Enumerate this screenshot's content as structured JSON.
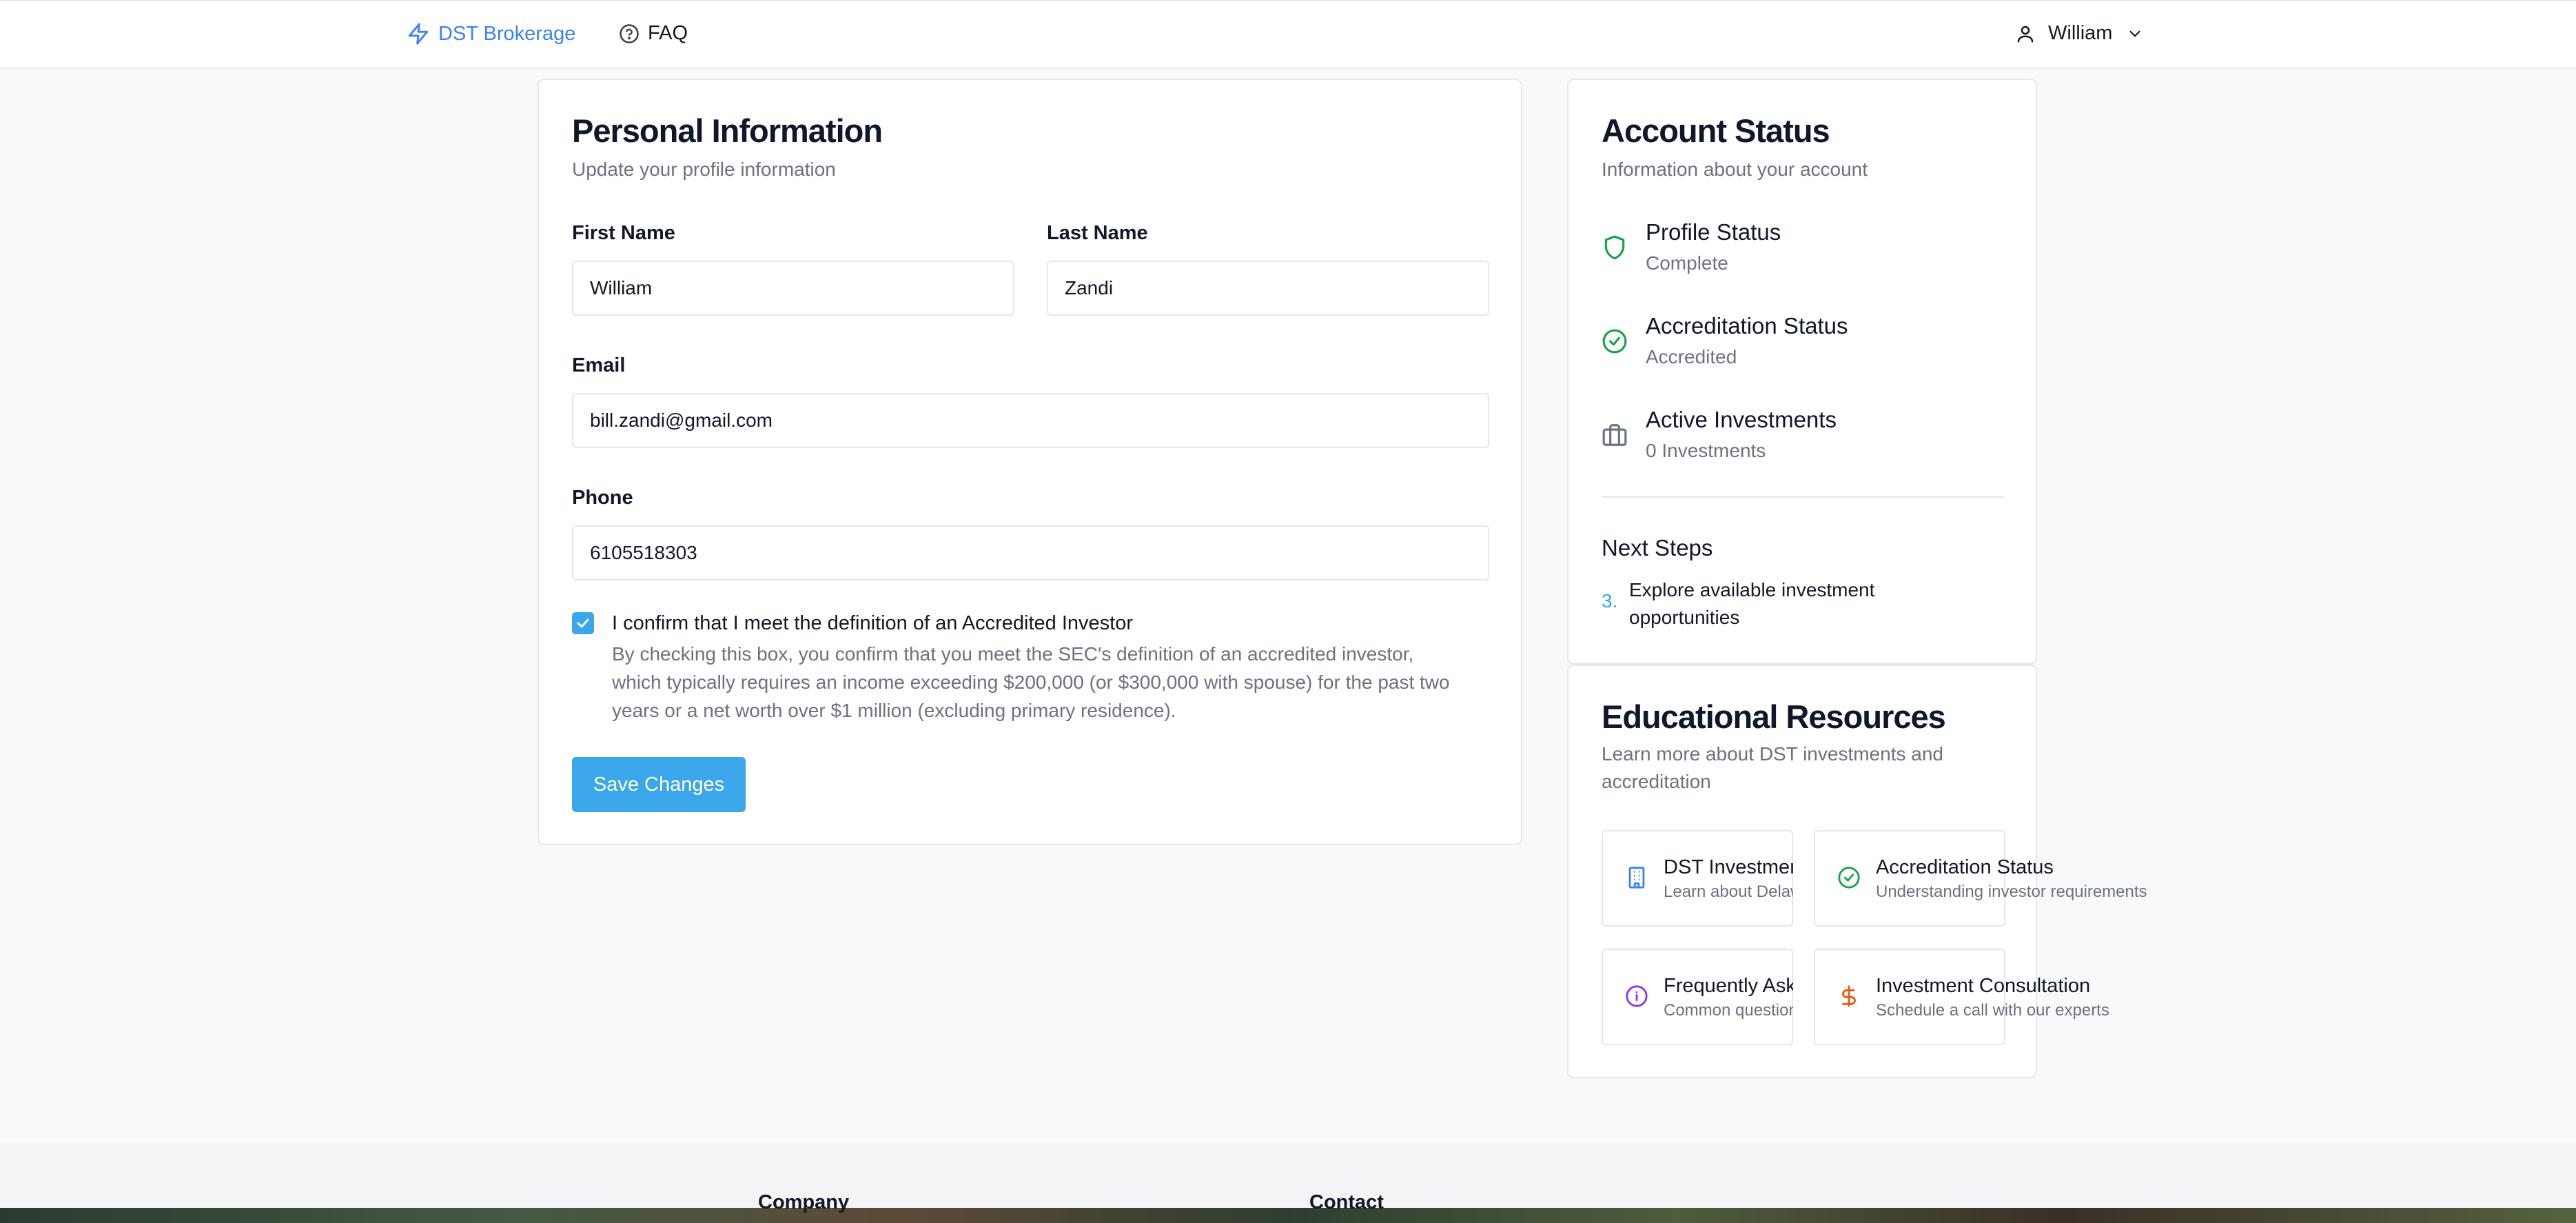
{
  "nav": {
    "brand": "DST Brokerage",
    "faq": "FAQ",
    "user": "William"
  },
  "personal": {
    "title": "Personal Information",
    "subtitle": "Update your profile information",
    "first_name_label": "First Name",
    "first_name_value": "William",
    "last_name_label": "Last Name",
    "last_name_value": "Zandi",
    "email_label": "Email",
    "email_value": "bill.zandi@gmail.com",
    "phone_label": "Phone",
    "phone_value": "6105518303",
    "accredited_checked": true,
    "accredited_label": "I confirm that I meet the definition of an Accredited Investor",
    "accredited_help": "By checking this box, you confirm that you meet the SEC's definition of an accredited investor, which typically requires an income exceeding $200,000 (or $300,000 with spouse) for the past two years or a net worth over $1 million (excluding primary residence).",
    "save_label": "Save Changes"
  },
  "account": {
    "title": "Account Status",
    "subtitle": "Information about your account",
    "items": [
      {
        "title": "Profile Status",
        "value": "Complete",
        "icon": "shield-icon"
      },
      {
        "title": "Accreditation Status",
        "value": "Accredited",
        "icon": "check-circle-icon"
      },
      {
        "title": "Active Investments",
        "value": "0 Investments",
        "icon": "briefcase-icon"
      }
    ],
    "next_steps_title": "Next Steps",
    "next_steps": [
      {
        "num": "3.",
        "text": "Explore available investment opportunities"
      }
    ]
  },
  "edu": {
    "title": "Educational Resources",
    "subtitle": "Learn more about DST investments and accreditation",
    "resources": [
      {
        "title": "DST Investments",
        "sub": "Learn about Delaware Statutory Trusts",
        "icon": "building-icon"
      },
      {
        "title": "Accreditation Status",
        "sub": "Understanding investor requirements",
        "icon": "check-circle-icon"
      },
      {
        "title": "Frequently Asked Questions",
        "sub": "Common questions answered",
        "icon": "info-icon"
      },
      {
        "title": "Investment Consultation",
        "sub": "Schedule a call with our experts",
        "icon": "dollar-icon"
      }
    ]
  },
  "footer": {
    "company": "Company",
    "contact": "Contact"
  },
  "colors": {
    "accent": "#3ba6ea",
    "brand": "#3b82f6",
    "success": "#16a34a",
    "purple": "#9333ea",
    "orange": "#ea580c"
  }
}
